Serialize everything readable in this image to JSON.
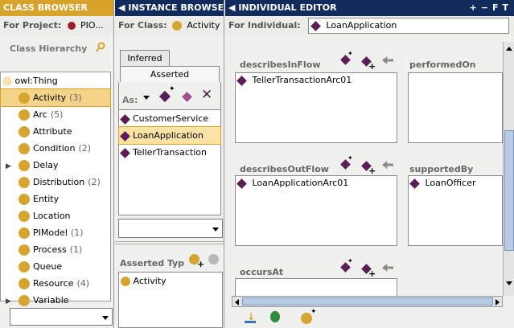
{
  "class_browser": {
    "title": "CLASS BROWSER",
    "project_label": "For Project:",
    "project_name": "PIO...",
    "hierarchy_label": "Class Hierarchy",
    "root": "owl:Thing",
    "items": [
      {
        "label": "Activity",
        "count": "(3)",
        "expandable": false,
        "selected": true
      },
      {
        "label": "Arc",
        "count": "(5)",
        "expandable": false
      },
      {
        "label": "Attribute",
        "count": "",
        "expandable": false
      },
      {
        "label": "Condition",
        "count": "(2)",
        "expandable": false
      },
      {
        "label": "Delay",
        "count": "",
        "expandable": true
      },
      {
        "label": "Distribution",
        "count": "(2)",
        "expandable": false
      },
      {
        "label": "Entity",
        "count": "",
        "expandable": false
      },
      {
        "label": "Location",
        "count": "",
        "expandable": false
      },
      {
        "label": "PIModel",
        "count": "(1)",
        "expandable": false
      },
      {
        "label": "Process",
        "count": "(1)",
        "expandable": false
      },
      {
        "label": "Queue",
        "count": "",
        "expandable": false
      },
      {
        "label": "Resource",
        "count": "(4)",
        "expandable": false
      },
      {
        "label": "Variable",
        "count": "",
        "expandable": true
      }
    ]
  },
  "instance_browser": {
    "title": "INSTANCE BROWSER",
    "class_label": "For Class:",
    "class_name": "Activity",
    "tabs": [
      "Inferred",
      "Asserted"
    ],
    "toolbar_label": "As:",
    "instances": [
      "CustomerService",
      "LoanApplication",
      "TellerTransaction"
    ],
    "selected_instance": "LoanApplication",
    "asserted_types_label": "Asserted Typ",
    "asserted_types": [
      "Activity"
    ]
  },
  "individual_editor": {
    "title": "INDIVIDUAL EDITOR",
    "title_buttons": [
      "+",
      "−",
      "F",
      "T"
    ],
    "individual_label": "For Individual:",
    "individual_name": "LoanApplication",
    "properties": {
      "describesInFlow": {
        "label": "describesInFlow",
        "values": [
          "TellerTransactionArc01"
        ]
      },
      "performedOn": {
        "label": "performedOn",
        "values": []
      },
      "describesOutFlow": {
        "label": "describesOutFlow",
        "values": [
          "LoanApplicationArc01"
        ]
      },
      "supportedBy": {
        "label": "supportedBy",
        "values": [
          "LoanOfficer"
        ]
      },
      "occursAt": {
        "label": "occursAt",
        "values": []
      }
    }
  },
  "colors": {
    "header_bg": "#112c5c",
    "header_bg_orange": "#d9a22a",
    "selection_orange": "#e8b444",
    "individual_purple": "#5a1e55",
    "class_gold": "#d6a531"
  }
}
